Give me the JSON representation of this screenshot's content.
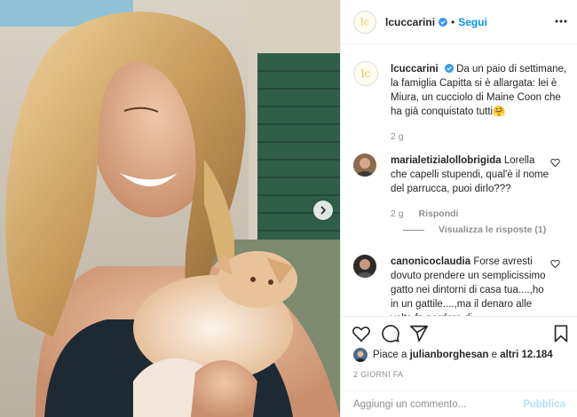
{
  "post": {
    "username": "lcuccarini",
    "follow_label": "Segui",
    "separator": "•",
    "photo_alt": "Woman with wavy blonde hair holding a ginger kitten"
  },
  "caption": {
    "username": "lcuccarini",
    "text": "Da un paio di settimane, la famiglia Capitta si è allargata: lei è Miura, un cucciolo di Maine Coon che ha già conquistato tutti🤗",
    "age": "2 g"
  },
  "comments": [
    {
      "username": "marialetizialollobrigida",
      "text": "Lorella che capelli stupendi, qual'è il nome del parrucca, puoi dirlo???",
      "age": "2 g",
      "reply_label": "Rispondi",
      "view_replies": "Visualizza le risposte (1)"
    },
    {
      "username": "canonicoclaudia",
      "text": "Forse avresti dovuto prendere un semplicissimo gatto nei dintorni di casa tua....,ho in un gattile....,ma il denaro alle volte fa perdere di"
    }
  ],
  "likes": {
    "prefix": "Piace a",
    "user": "julianborghesan",
    "conjunction": "e",
    "others": "altri 12.184"
  },
  "timestamp": "2 GIORNI FA",
  "add_comment": {
    "placeholder": "Aggiungi un commento...",
    "publish_label": "Pubblica"
  },
  "icons": {
    "verified": "verified-badge-icon",
    "more": "more-options-icon",
    "like": "heart-icon",
    "comment": "comment-bubble-icon",
    "share": "paper-plane-icon",
    "save": "bookmark-icon",
    "next": "chevron-right-icon"
  },
  "colors": {
    "link": "#0095f6",
    "verified": "#3897f0",
    "text": "#262626",
    "muted": "#8e8e8e",
    "publish_disabled": "#b2dffc"
  }
}
